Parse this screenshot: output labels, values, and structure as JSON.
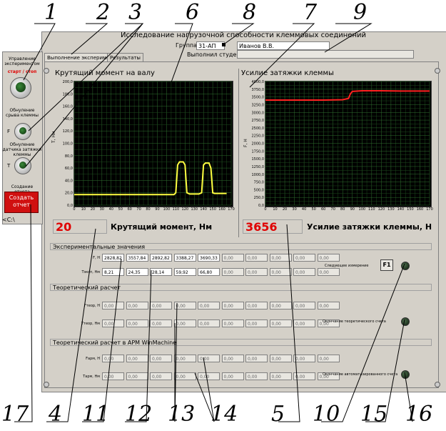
{
  "window": {
    "title": "Исследование нагрузочной способности клеммовых соединений"
  },
  "group": {
    "label": "Группа",
    "value": "31-АП",
    "student_value": "Иванов В.В.",
    "performed_label": "Выполнил студент"
  },
  "tabs": [
    {
      "label": "Выполнение эксперимента"
    },
    {
      "label": "Результаты"
    }
  ],
  "left_panel": {
    "control_label": "Управление экспериментом",
    "start_stop": "старт / стоп",
    "reset_break_label": "Обнуление срыва клеммы",
    "reset_tension_label": "Обнуление датчика затяжки клеммы",
    "f_letter": "F",
    "t_letter": "T",
    "report_label": "Создание отчета",
    "report_button": "Создать отчет",
    "bottom_label": "<С:\\"
  },
  "torque_chart": {
    "title": "Крутящий момент на валу",
    "ylabel": "T, Нм",
    "readout": "20",
    "readout_label": "Крутящий момент, Нм"
  },
  "tension_chart": {
    "title": "Усилие затяжки клеммы",
    "ylabel": "F, Н",
    "readout": "3656",
    "readout_label": "Усилие затяжки клеммы, Н"
  },
  "chart_data": [
    {
      "type": "line",
      "title": "Крутящий момент на валу",
      "ylabel": "T, Нм",
      "xlim": [
        0,
        170
      ],
      "ylim": [
        0,
        200
      ],
      "xticks": [
        "0",
        "10",
        "20",
        "30",
        "40",
        "50",
        "60",
        "70",
        "80",
        "90",
        "100",
        "110",
        "120",
        "130",
        "140",
        "150",
        "160",
        "170"
      ],
      "yticks": [
        "0,0",
        "20,0",
        "40,0",
        "60,0",
        "80,0",
        "100,0",
        "120,0",
        "140,0",
        "160,0",
        "180,0",
        "200,0"
      ],
      "color": "#ffff40",
      "x": [
        0,
        20,
        40,
        60,
        80,
        100,
        108,
        110,
        112,
        114,
        118,
        120,
        122,
        125,
        130,
        135,
        138,
        140,
        142,
        146,
        148,
        150,
        152,
        155,
        160,
        165
      ],
      "y": [
        17,
        17,
        17,
        17,
        17,
        17,
        17,
        20,
        65,
        70,
        70,
        65,
        20,
        18,
        18,
        18,
        20,
        65,
        68,
        68,
        60,
        20,
        19,
        19,
        19,
        19
      ]
    },
    {
      "type": "line",
      "title": "Усилие затяжки клеммы",
      "ylabel": "F, Н",
      "xlim": [
        0,
        170
      ],
      "ylim": [
        0,
        4000
      ],
      "xticks": [
        "0",
        "10",
        "20",
        "30",
        "40",
        "50",
        "60",
        "70",
        "80",
        "90",
        "100",
        "110",
        "120",
        "130",
        "140",
        "150",
        "160",
        "170"
      ],
      "yticks": [
        "0,0",
        "250,0",
        "500,0",
        "750,0",
        "1000,0",
        "1250,0",
        "1500,0",
        "1750,0",
        "2000,0",
        "2250,0",
        "2500,0",
        "2750,0",
        "3000,0",
        "3250,0",
        "3500,0",
        "3750,0",
        "4000,0"
      ],
      "color": "#ff2020",
      "x": [
        0,
        20,
        40,
        60,
        80,
        86,
        88,
        90,
        100,
        120,
        140,
        160,
        170
      ],
      "y": [
        3400,
        3400,
        3400,
        3400,
        3410,
        3450,
        3600,
        3680,
        3700,
        3700,
        3690,
        3690,
        3690
      ]
    }
  ],
  "experimental": {
    "header": "Экспериментальные значения",
    "f_label": "F, Н",
    "t_label": "Тэксп, Нм",
    "f_values": [
      "2828,82",
      "3557,84",
      "2892,82",
      "3388,27",
      "3690,33",
      "0,00",
      "0,00",
      "0,00",
      "0,00",
      "0,00"
    ],
    "t_values": [
      "8,21",
      "24,35",
      "28,14",
      "59,92",
      "66,80",
      "0,00",
      "0,00",
      "0,00",
      "0,00",
      "0,00"
    ],
    "next_label": "Следующее измерение",
    "f1": "F1"
  },
  "theoretical": {
    "header": "Теоретический расчет",
    "f_label": "Fтеор, Н",
    "t_label": "Tтеор, Нм",
    "f_values": [
      "0,00",
      "0,00",
      "0,00",
      "0,00",
      "0,00",
      "0,00",
      "0,00",
      "0,00",
      "0,00",
      "0,00"
    ],
    "t_values": [
      "0,00",
      "0,00",
      "0,00",
      "0,00",
      "0,00",
      "0,00",
      "0,00",
      "0,00",
      "0,00",
      "0,00"
    ],
    "end_label": "Окончание теоретического счета"
  },
  "apm": {
    "header": "Теоретический расчет в APM WinMachine",
    "f_label": "Fарм, Н",
    "t_label": "Tарм, Нм",
    "f_values": [
      "0,00",
      "0,00",
      "0,00",
      "0,00",
      "0,00",
      "0,00",
      "0,00",
      "0,00",
      "0,00",
      "0,00"
    ],
    "t_values": [
      "0,00",
      "0,00",
      "0,00",
      "0,00",
      "0,00",
      "0,00",
      "0,00",
      "0,00",
      "0,00",
      "0,00"
    ],
    "end_label": "Окончание автоматизированного счета"
  },
  "callouts": [
    "1",
    "2",
    "3",
    "6",
    "8",
    "7",
    "9",
    "17",
    "4",
    "11",
    "12",
    "13",
    "14",
    "5",
    "10",
    "15",
    "16"
  ]
}
